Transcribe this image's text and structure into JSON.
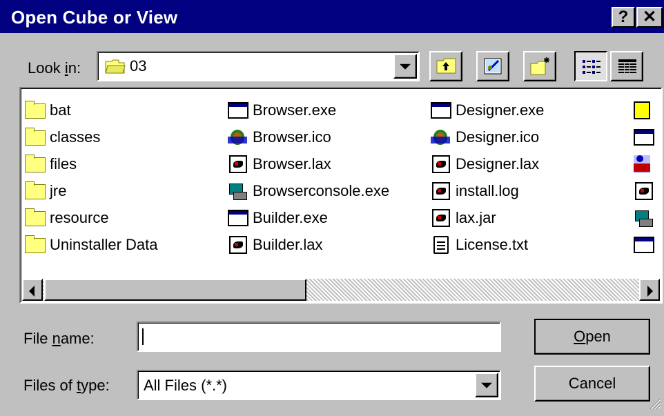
{
  "window": {
    "title": "Open Cube or View",
    "help_button": "?",
    "close_button": "✕"
  },
  "look_in": {
    "label_pre": "Look ",
    "label_accel": "i",
    "label_post": "n:",
    "value": "03"
  },
  "toolbar": {
    "up_one_level": "up-folder-icon",
    "desktop": "desktop-icon",
    "new_folder": "new-folder-icon",
    "list_view": "list-view-icon",
    "details_view": "details-view-icon"
  },
  "files": {
    "col1": [
      {
        "name": "bat",
        "icon": "folder"
      },
      {
        "name": "classes",
        "icon": "folder"
      },
      {
        "name": "files",
        "icon": "folder"
      },
      {
        "name": "jre",
        "icon": "folder"
      },
      {
        "name": "resource",
        "icon": "folder"
      },
      {
        "name": "Uninstaller Data",
        "icon": "folder"
      }
    ],
    "col2": [
      {
        "name": "Browser.exe",
        "icon": "exe"
      },
      {
        "name": "Browser.ico",
        "icon": "ico"
      },
      {
        "name": "Browser.lax",
        "icon": "lax"
      },
      {
        "name": "Browserconsole.exe",
        "icon": "console"
      },
      {
        "name": "Builder.exe",
        "icon": "exe"
      },
      {
        "name": "Builder.lax",
        "icon": "lax"
      }
    ],
    "col3": [
      {
        "name": "Designer.exe",
        "icon": "exe"
      },
      {
        "name": "Designer.ico",
        "icon": "ico"
      },
      {
        "name": "Designer.lax",
        "icon": "lax"
      },
      {
        "name": "install.log",
        "icon": "lax"
      },
      {
        "name": "lax.jar",
        "icon": "lax"
      },
      {
        "name": "License.txt",
        "icon": "txt"
      }
    ]
  },
  "file_name": {
    "label_pre": "File ",
    "label_accel": "n",
    "label_post": "ame:",
    "value": ""
  },
  "file_type": {
    "label_pre": "Files of ",
    "label_accel": "t",
    "label_post": "ype:",
    "value": "All Files (*.*)"
  },
  "buttons": {
    "open_accel": "O",
    "open_rest": "pen",
    "cancel": "Cancel"
  }
}
